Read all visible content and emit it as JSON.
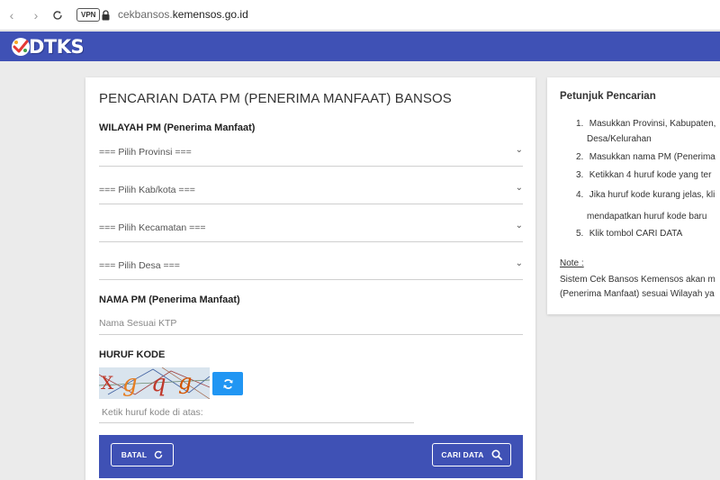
{
  "browser": {
    "vpn_label": "VPN",
    "url_prefix": "cekbansos.",
    "url_domain": "kemensos.go.id"
  },
  "header": {
    "logo_text": "DTKS",
    "brand_color": "#3f51b5"
  },
  "form": {
    "title": "PENCARIAN DATA PM (PENERIMA MANFAAT) BANSOS",
    "wilayah_label": "WILAYAH PM (Penerima Manfaat)",
    "selects": [
      "=== Pilih Provinsi ===",
      "=== Pilih Kab/kota ===",
      "=== Pilih Kecamatan ===",
      "=== Pilih Desa ==="
    ],
    "nama_label": "NAMA PM (Penerima Manfaat)",
    "nama_placeholder": "Nama Sesuai KTP",
    "kode_label": "HURUF KODE",
    "captcha_text": "Xgqg",
    "kode_placeholder": "Ketik huruf kode di atas:",
    "batal_label": "BATAL",
    "cari_label": "CARI DATA"
  },
  "guide": {
    "title": "Petunjuk Pencarian",
    "steps": [
      {
        "num": "1.",
        "line1": "Masukkan Provinsi, Kabupaten,",
        "line2": "Desa/Kelurahan"
      },
      {
        "num": "2.",
        "line1": "Masukkan nama PM (Penerima"
      },
      {
        "num": "3.",
        "line1": "Ketikkan 4 huruf kode yang ter"
      },
      {
        "num": "4.",
        "line1": "Jika huruf kode kurang jelas, kli",
        "line2": "mendapatkan huruf kode baru"
      },
      {
        "num": "5.",
        "line1": "Klik tombol CARI DATA"
      }
    ],
    "note_label": "Note :",
    "note_line1": "Sistem Cek Bansos Kemensos akan m",
    "note_line2": "(Penerima Manfaat) sesuai Wilayah ya"
  }
}
